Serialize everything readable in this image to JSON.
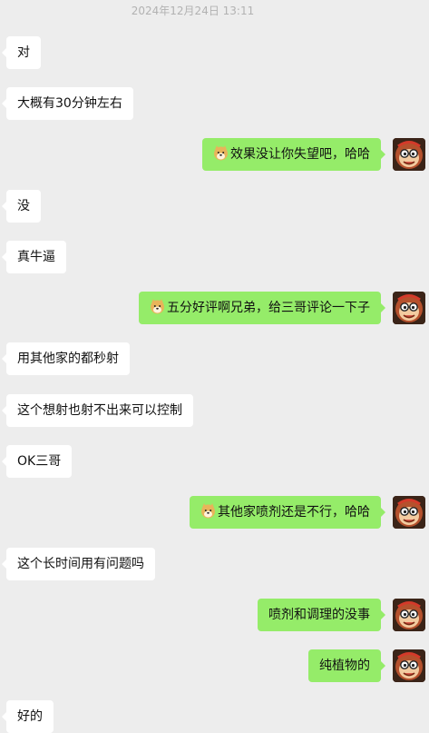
{
  "timestamp": "2024年12月24日 13:11",
  "messages": [
    {
      "side": "in",
      "text": "对"
    },
    {
      "side": "in",
      "text": "大概有30分钟左右"
    },
    {
      "side": "out",
      "emoji": "doge-emoji",
      "text": "效果没让你失望吧，哈哈"
    },
    {
      "side": "in",
      "text": "没"
    },
    {
      "side": "in",
      "text": "真牛逼"
    },
    {
      "side": "out",
      "emoji": "doge-emoji",
      "text": "五分好评啊兄弟，给三哥评论一下子"
    },
    {
      "side": "in",
      "text": "用其他家的都秒射"
    },
    {
      "side": "in",
      "text": "这个想射也射不出来可以控制"
    },
    {
      "side": "in",
      "text": "OK三哥"
    },
    {
      "side": "out",
      "emoji": "doge-emoji",
      "text": "其他家喷剂还是不行，哈哈"
    },
    {
      "side": "in",
      "text": "这个长时间用有问题吗"
    },
    {
      "side": "out",
      "text": "喷剂和调理的没事"
    },
    {
      "side": "out",
      "text": "纯植物的"
    },
    {
      "side": "in",
      "text": "好的"
    }
  ],
  "colors": {
    "background": "#ededed",
    "incoming_bubble": "#ffffff",
    "outgoing_bubble": "#95ec69",
    "timestamp_text": "#b2b2b2"
  },
  "icons": {
    "avatar": "monkey-avatar-icon",
    "emoji": "doge-emoji-icon"
  }
}
